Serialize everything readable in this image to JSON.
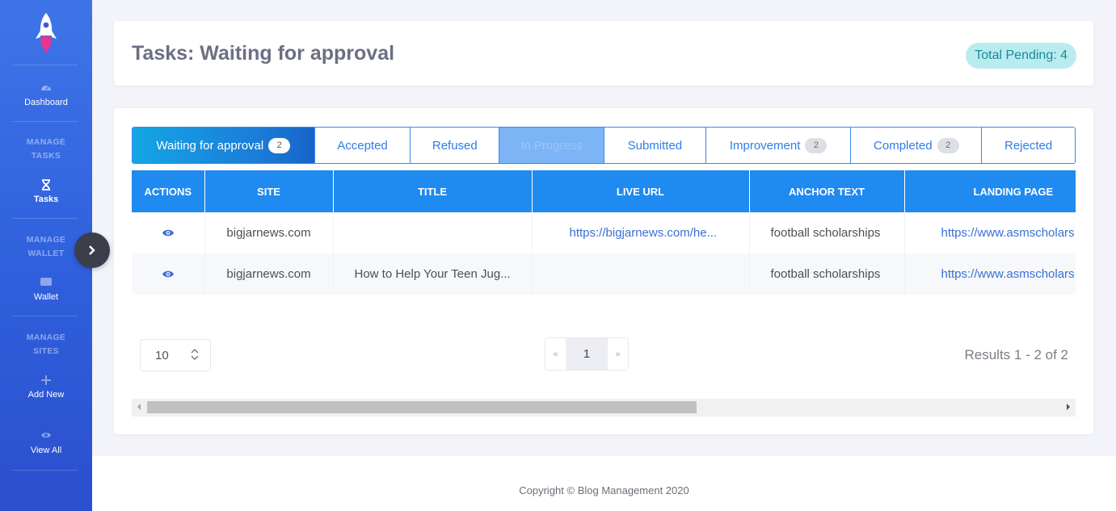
{
  "sidebar": {
    "dashboard_label": "Dashboard",
    "heading_tasks": "MANAGE TASKS",
    "tasks_label": "Tasks",
    "heading_wallet": "MANAGE WALLET",
    "wallet_label": "Wallet",
    "heading_sites": "MANAGE SITES",
    "add_new_label": "Add New",
    "view_all_label": "View All",
    "collapse_icon": "chevron-right-icon"
  },
  "header": {
    "title": "Tasks: Waiting for approval",
    "pending_badge": "Total Pending: 4"
  },
  "tabs": [
    {
      "label": "Waiting for approval",
      "count": "2"
    },
    {
      "label": "Accepted",
      "count": ""
    },
    {
      "label": "Refused",
      "count": ""
    },
    {
      "label": "In Progress",
      "count": ""
    },
    {
      "label": "Submitted",
      "count": ""
    },
    {
      "label": "Improvement",
      "count": "2"
    },
    {
      "label": "Completed",
      "count": "2"
    },
    {
      "label": "Rejected",
      "count": ""
    }
  ],
  "table": {
    "columns": [
      "Actions",
      "Site",
      "Title",
      "Live URL",
      "Anchor Text",
      "Landing Page"
    ],
    "rows": [
      {
        "site": "bigjarnews.com",
        "title": "",
        "live_url": "https://bigjarnews.com/he...",
        "anchor_text": "football scholarships",
        "landing_page": "https://www.asmscholars"
      },
      {
        "site": "bigjarnews.com",
        "title": "How to Help Your Teen Jug...",
        "live_url": "",
        "anchor_text": "football scholarships",
        "landing_page": "https://www.asmscholars"
      }
    ]
  },
  "pagination": {
    "per_page": "10",
    "prev": "«",
    "current_page": "1",
    "next": "»",
    "results": "Results 1 - 2 of 2"
  },
  "footer": {
    "copyright": "Copyright © Blog Management 2020"
  },
  "colors": {
    "sidebar": "#3a6ae6",
    "primary": "#1f8af0",
    "badge_bg": "#b9ecef",
    "badge_text": "#1a8a98"
  }
}
